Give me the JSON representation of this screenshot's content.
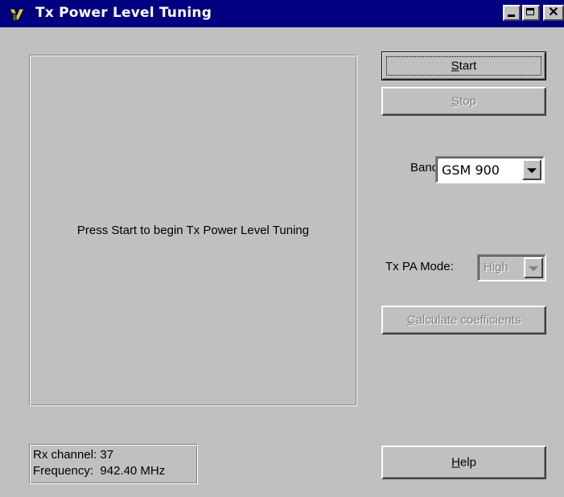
{
  "window": {
    "title": "Tx Power Level Tuning",
    "titlebar_color": "#000080",
    "close_glyph": "✕"
  },
  "main": {
    "message": "Press Start to begin Tx Power Level Tuning"
  },
  "controls": {
    "start": {
      "first": "S",
      "rest": "tart",
      "enabled": true
    },
    "stop": {
      "first": "S",
      "rest": "top",
      "enabled": false
    },
    "band_label": "Band:",
    "band_value": "GSM 900",
    "pa_mode_label": "Tx PA Mode:",
    "pa_mode_value": "High",
    "calc": {
      "first": "C",
      "rest": "alculate coefficients",
      "enabled": false
    },
    "help": {
      "first": "H",
      "rest": "elp",
      "enabled": true
    }
  },
  "status": {
    "rx_channel_label": "Rx channel:",
    "rx_channel_value": "37",
    "frequency_label": "Frequency:",
    "frequency_value": "942.40 MHz"
  }
}
